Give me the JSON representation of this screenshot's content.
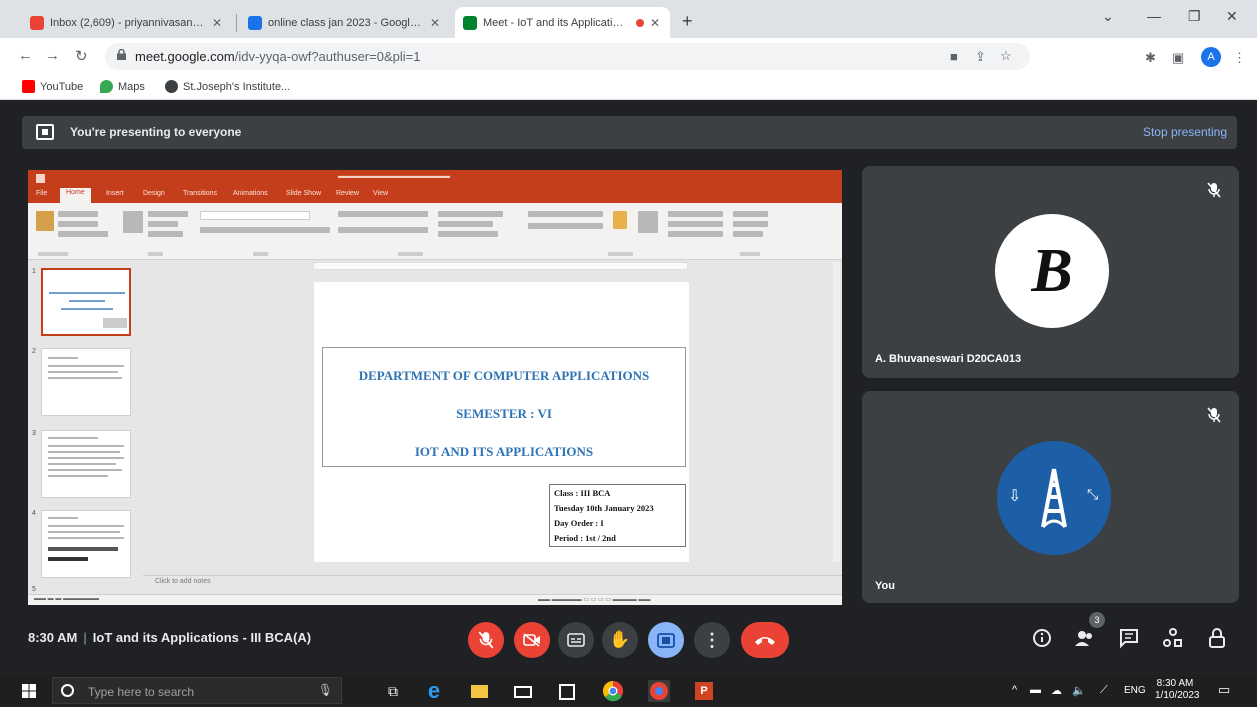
{
  "browser": {
    "tabs": [
      {
        "title": "Inbox (2,609) - priyannivasan0…",
        "favicon_color": "#ea4335",
        "active": false
      },
      {
        "title": "online class jan 2023 - Google D…",
        "favicon_color": "#1a73e8",
        "active": false
      },
      {
        "title": "Meet - IoT and its Applicati…",
        "favicon_color": "#00832d",
        "active": true
      }
    ],
    "new_tab_glyph": "+",
    "url_host": "meet.google.com",
    "url_path": "/idv-yyqa-owf?authuser=0&pli=1",
    "profile_initial": "A",
    "bookmarks": [
      "YouTube",
      "Maps",
      "St.Joseph's Institute..."
    ],
    "bookmark_colors": [
      "#ff0000",
      "#34a853",
      "#3c4043"
    ]
  },
  "meet": {
    "banner_text": "You're presenting to everyone",
    "stop_presenting": "Stop presenting",
    "meeting_time": "8:30 AM",
    "meeting_separator": "|",
    "meeting_title": "IoT and its Applications - III BCA(A)",
    "participant_count": "3",
    "participants": [
      {
        "name": "A. Bhuvaneswari D20CA013",
        "avatar_letter": "B"
      },
      {
        "name": "You",
        "avatar_letter": "A"
      }
    ],
    "controls": [
      "mic-off",
      "camera-off",
      "captions",
      "raise-hand",
      "present",
      "more-options",
      "leave-call"
    ],
    "right_controls": [
      "meeting-details",
      "people",
      "chat",
      "activities",
      "host-controls"
    ]
  },
  "powerpoint": {
    "tabs": [
      "File",
      "Home",
      "Insert",
      "Design",
      "Transitions",
      "Animations",
      "Slide Show",
      "Review",
      "View"
    ],
    "slide_numbers": [
      "1",
      "2",
      "3",
      "4",
      "5"
    ],
    "notes_placeholder": "Click to add notes",
    "slide": {
      "line1": "DEPARTMENT OF COMPUTER APPLICATIONS",
      "line2": "SEMESTER : VI",
      "line3": "IOT AND ITS APPLICATIONS",
      "info": [
        "Class : III BCA",
        "Tuesday  10th January 2023",
        "Day Order : I",
        "Period : 1st / 2nd"
      ]
    }
  },
  "taskbar": {
    "search_placeholder": "Type here to search",
    "language": "ENG",
    "time": "8:30 AM",
    "date": "1/10/2023"
  }
}
